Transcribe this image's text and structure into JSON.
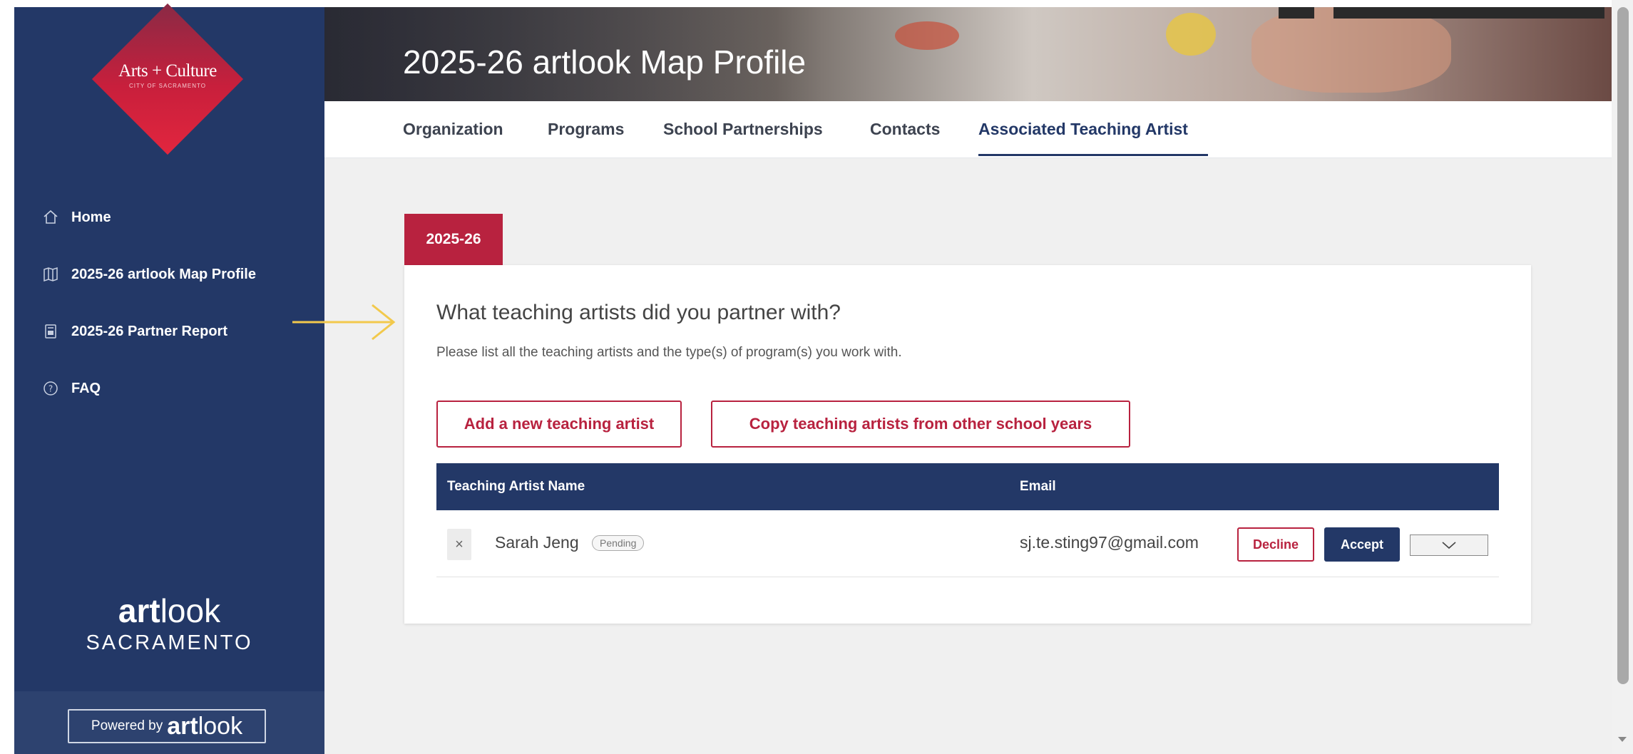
{
  "sidebar": {
    "logo_text": "Arts + Culture",
    "logo_sub": "CITY OF SACRAMENTO",
    "items": [
      {
        "label": "Home",
        "icon": "home-icon"
      },
      {
        "label": "2025-26 artlook Map Profile",
        "icon": "map-icon"
      },
      {
        "label": "2025-26 Partner Report",
        "icon": "report-icon"
      },
      {
        "label": "FAQ",
        "icon": "help-icon"
      }
    ],
    "brand_bold": "art",
    "brand_light": "look",
    "brand_city": "SACRAMENTO",
    "powered_by": "Powered by",
    "powered_bold": "art",
    "powered_light": "look"
  },
  "banner": {
    "title": "2025-26 artlook Map Profile"
  },
  "tabs": [
    {
      "label": "Organization"
    },
    {
      "label": "Programs"
    },
    {
      "label": "School Partnerships"
    },
    {
      "label": "Contacts"
    },
    {
      "label": "Associated Teaching Artist",
      "active": true
    }
  ],
  "year_tab": "2025-26",
  "card": {
    "question": "What teaching artists did you partner with?",
    "subtitle": "Please list all the teaching artists and the type(s) of program(s) you work with.",
    "add_button": "Add a new teaching artist",
    "copy_button": "Copy teaching artists from other school years"
  },
  "table": {
    "columns": [
      "Teaching Artist Name",
      "Email"
    ],
    "rows": [
      {
        "remove": "×",
        "name": "Sarah Jeng",
        "status": "Pending",
        "email": "sj.te.sting97@gmail.com",
        "decline": "Decline",
        "accept": "Accept"
      }
    ]
  },
  "colors": {
    "navy": "#233867",
    "crimson": "#b8223f",
    "annotation_arrow": "#f2c94c"
  }
}
